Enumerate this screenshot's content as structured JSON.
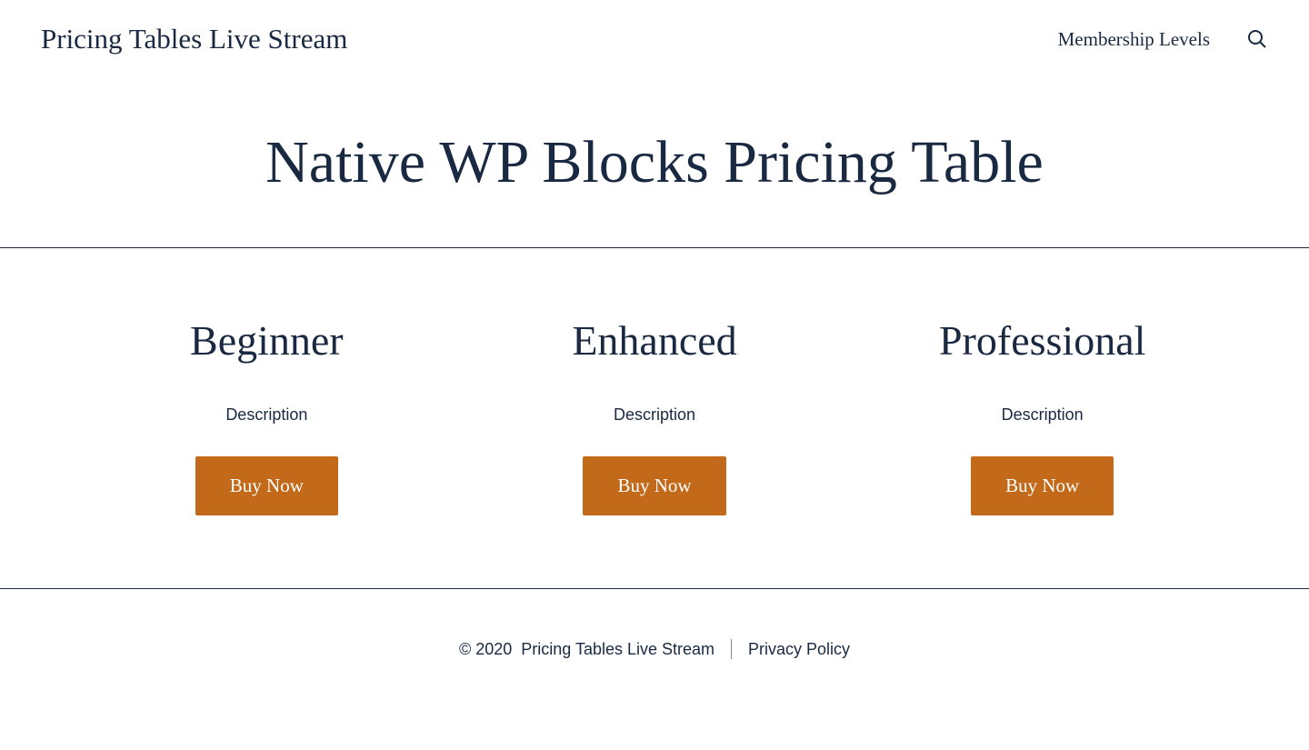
{
  "header": {
    "site_title": "Pricing Tables Live Stream",
    "nav": {
      "membership": "Membership Levels"
    }
  },
  "page": {
    "title": "Native WP Blocks Pricing Table"
  },
  "plans": [
    {
      "title": "Beginner",
      "description": "Description",
      "button": "Buy Now"
    },
    {
      "title": "Enhanced",
      "description": "Description",
      "button": "Buy Now"
    },
    {
      "title": "Professional",
      "description": "Description",
      "button": "Buy Now"
    }
  ],
  "footer": {
    "copyright": "© 2020",
    "site_name": "Pricing Tables Live Stream",
    "privacy": "Privacy Policy"
  },
  "colors": {
    "text": "#1a2942",
    "accent": "#c26a1a"
  }
}
